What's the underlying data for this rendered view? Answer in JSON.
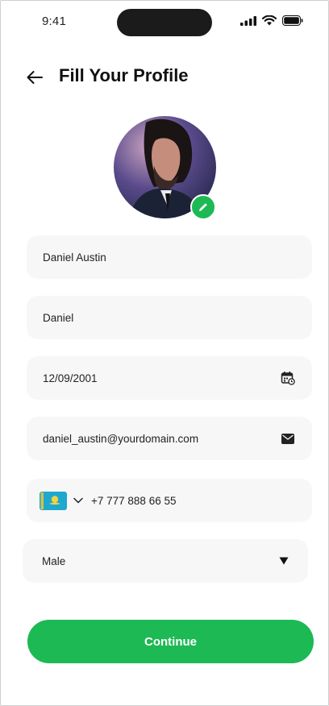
{
  "status_bar": {
    "time": "9:41"
  },
  "header": {
    "title": "Fill Your Profile"
  },
  "form": {
    "full_name": "Daniel Austin",
    "nickname": "Daniel",
    "date_of_birth": "12/09/2001",
    "email": "daniel_austin@yourdomain.com",
    "phone": "+7 777 888 66 55",
    "gender": "Male"
  },
  "icons": {
    "back": "arrow-left-icon",
    "edit": "pencil-icon",
    "calendar": "calendar-icon",
    "email": "envelope-icon",
    "country_flag": "kazakhstan-flag-icon",
    "dropdown": "triangle-down-icon"
  },
  "buttons": {
    "continue": "Continue"
  },
  "colors": {
    "accent": "#1db954",
    "field_bg": "#f7f7f7"
  }
}
